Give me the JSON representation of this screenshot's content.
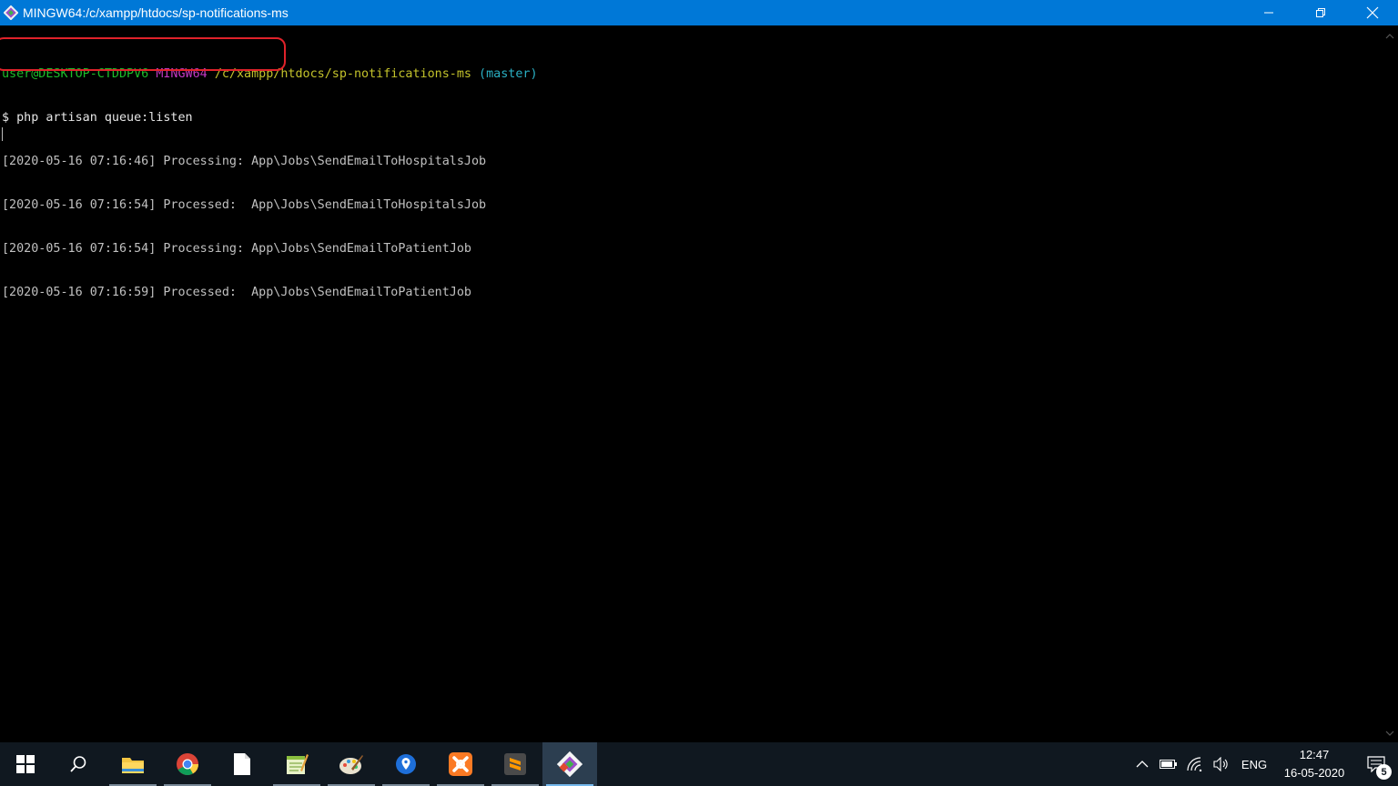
{
  "window": {
    "title": "MINGW64:/c/xampp/htdocs/sp-notifications-ms",
    "minimize_icon": "minimize-icon",
    "restore_icon": "restore-icon",
    "close_icon": "close-icon"
  },
  "terminal": {
    "prompt": {
      "user_host": "user@DESKTOP-CTDDPV6",
      "shell": "MINGW64",
      "path": "/c/xampp/htdocs/sp-notifications-ms",
      "branch": "(master)"
    },
    "command": "$ php artisan queue:listen",
    "output": [
      "[2020-05-16 07:16:46] Processing: App\\Jobs\\SendEmailToHospitalsJob",
      "[2020-05-16 07:16:54] Processed:  App\\Jobs\\SendEmailToHospitalsJob",
      "[2020-05-16 07:16:54] Processing: App\\Jobs\\SendEmailToPatientJob",
      "[2020-05-16 07:16:59] Processed:  App\\Jobs\\SendEmailToPatientJob"
    ],
    "colors": {
      "background": "#000000",
      "user_host": "#1cbe2a",
      "shell": "#c238c2",
      "path": "#c4c32b",
      "branch": "#2ab0c4",
      "text": "#c0c0c0",
      "annotation": "#e0222a"
    }
  },
  "taskbar": {
    "apps": [
      {
        "name": "File Explorer",
        "icon": "folder-icon"
      },
      {
        "name": "Google Chrome",
        "icon": "chrome-icon"
      },
      {
        "name": "Document",
        "icon": "document-icon"
      },
      {
        "name": "Notepad++",
        "icon": "notepadpp-icon"
      },
      {
        "name": "Paint",
        "icon": "paint-icon"
      },
      {
        "name": "Maps",
        "icon": "map-pin-icon"
      },
      {
        "name": "XAMPP",
        "icon": "xampp-icon"
      },
      {
        "name": "Sublime Text",
        "icon": "sublime-icon"
      },
      {
        "name": "Git Bash",
        "icon": "git-icon"
      }
    ],
    "tray": {
      "language": "ENG",
      "time": "12:47",
      "date": "16-05-2020",
      "notification_count": "5"
    }
  }
}
